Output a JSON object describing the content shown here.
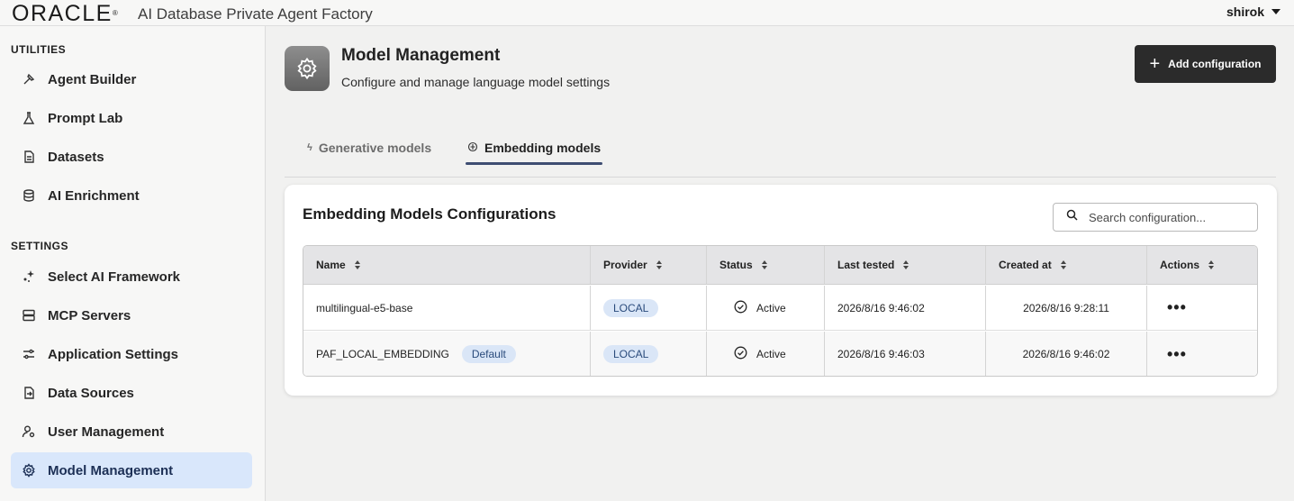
{
  "header": {
    "logo": "ORACLE",
    "app_title": "AI Database Private Agent Factory",
    "user": "shirok"
  },
  "sidebar": {
    "utilities_title": "UTILITIES",
    "settings_title": "SETTINGS",
    "utilities": [
      {
        "label": "Agent Builder",
        "icon": "hammer-icon"
      },
      {
        "label": "Prompt Lab",
        "icon": "flask-icon"
      },
      {
        "label": "Datasets",
        "icon": "document-icon"
      },
      {
        "label": "AI Enrichment",
        "icon": "database-icon"
      }
    ],
    "settings": [
      {
        "label": "Select AI Framework",
        "icon": "sparkle-icon"
      },
      {
        "label": "MCP Servers",
        "icon": "server-icon"
      },
      {
        "label": "Application Settings",
        "icon": "sliders-icon"
      },
      {
        "label": "Data Sources",
        "icon": "file-import-icon"
      },
      {
        "label": "User Management",
        "icon": "user-gear-icon"
      },
      {
        "label": "Model Management",
        "icon": "cog-icon",
        "active": true
      }
    ]
  },
  "page": {
    "title": "Model Management",
    "subtitle": "Configure and manage language model settings",
    "add_button": "Add configuration"
  },
  "tabs": [
    {
      "label": "Generative models",
      "icon": "bolt-icon",
      "active": false
    },
    {
      "label": "Embedding models",
      "icon": "embedding-icon",
      "active": true
    }
  ],
  "card": {
    "title": "Embedding Models Configurations",
    "search_placeholder": "Search configuration..."
  },
  "table": {
    "columns": [
      "Name",
      "Provider",
      "Status",
      "Last tested",
      "Created at",
      "Actions"
    ],
    "rows": [
      {
        "name": "multilingual-e5-base",
        "badge": "",
        "provider": "LOCAL",
        "status": "Active",
        "last_tested": "2026/8/16 9:46:02",
        "created_at": "2026/8/16 9:28:11",
        "actions": "•••"
      },
      {
        "name": "PAF_LOCAL_EMBEDDING",
        "badge": "Default",
        "provider": "LOCAL",
        "status": "Active",
        "last_tested": "2026/8/16 9:46:03",
        "created_at": "2026/8/16 9:46:02",
        "actions": "•••"
      }
    ]
  },
  "colors": {
    "active_nav_bg": "#d9e7fb",
    "primary_button": "#2b2b2b",
    "tab_underline": "#3e4d72",
    "badge_bg": "#dae6f7"
  }
}
